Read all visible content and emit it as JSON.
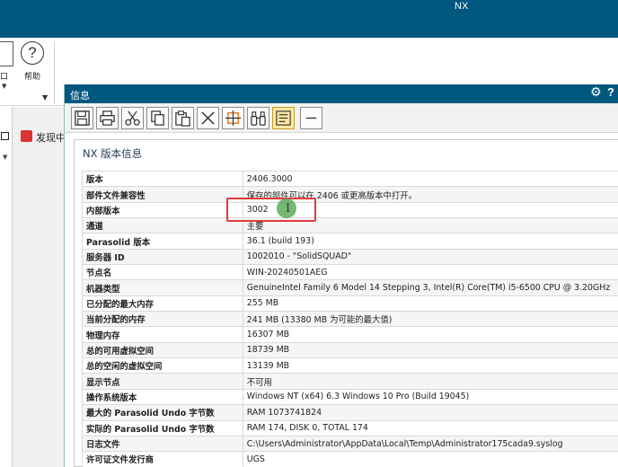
{
  "app": {
    "title": "NX"
  },
  "ribbon": {
    "partial_label": "口",
    "help_label": "帮助"
  },
  "navigator": {
    "discover_label": "发现中"
  },
  "dialog": {
    "title": "信息",
    "content_title": "NX 版本信息",
    "rows": [
      {
        "key": "版本",
        "value": "2406.3000"
      },
      {
        "key": "部件文件兼容性",
        "value": "保存的部件可以在 2406 或更高版本中打开。"
      },
      {
        "key": "内部版本",
        "value": "3002"
      },
      {
        "key": "通道",
        "value": "主要"
      },
      {
        "key": "Parasolid 版本",
        "value": "36.1 (build 193)"
      },
      {
        "key": "服务器 ID",
        "value": "1002010 - \"SolidSQUAD\""
      },
      {
        "key": "节点名",
        "value": "WIN-20240501AEG"
      },
      {
        "key": "机器类型",
        "value": "GenuineIntel Family 6 Model 14 Stepping 3, Intel(R) Core(TM) i5-6500 CPU @ 3.20GHz"
      },
      {
        "key": "已分配的最大内存",
        "value": "255 MB"
      },
      {
        "key": "当前分配的内存",
        "value": "241 MB (13380 MB 为可能的最大值)"
      },
      {
        "key": "物理内存",
        "value": "16307 MB"
      },
      {
        "key": "总的可用虚拟空间",
        "value": "18739 MB"
      },
      {
        "key": "总的空闲的虚拟空间",
        "value": "13139 MB"
      },
      {
        "key": "显示节点",
        "value": "不可用"
      },
      {
        "key": "操作系统版本",
        "value": "Windows NT (x64) 6.3 Windows 10 Pro (Build 19045)"
      },
      {
        "key": "最大的 Parasolid Undo 字节数",
        "value": "RAM 1073741824"
      },
      {
        "key": "实际的 Parasolid Undo 字节数",
        "value": "RAM 174, DISK 0, TOTAL 174"
      },
      {
        "key": "日志文件",
        "value": "C:\\Users\\Administrator\\AppData\\Local\\Temp\\Administrator175cada9.syslog"
      },
      {
        "key": "许可证文件发行商",
        "value": "UGS"
      }
    ]
  },
  "icons": {
    "toolbar": [
      "save-icon",
      "print-icon",
      "cut-icon",
      "copy-icon",
      "paste-icon",
      "delete-icon",
      "find-icon",
      "binoculars-icon",
      "wrap-text-icon",
      "minimize-icon"
    ],
    "dialog": [
      "gear-icon",
      "help-icon"
    ]
  },
  "colors": {
    "titlebar": "#00587f",
    "highlight": "#e23b3b",
    "active_tool": "#ffe9a0"
  }
}
